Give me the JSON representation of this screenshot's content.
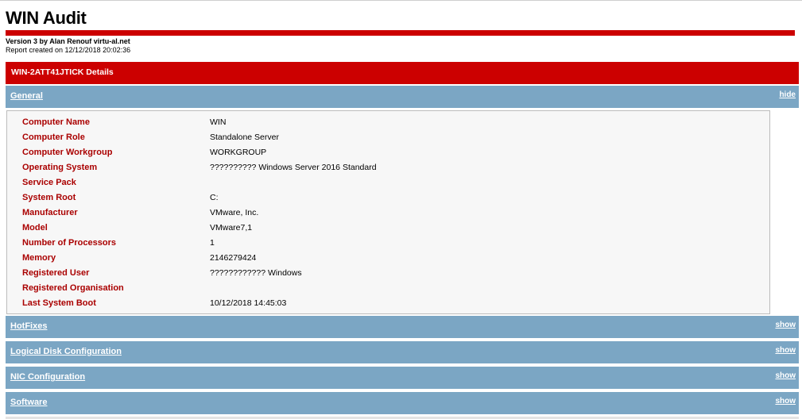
{
  "report": {
    "title": "WIN Audit",
    "version": "Version 3 by Alan Renouf virtu-al.net",
    "created": "Report created on 12/12/2018 20:02:36"
  },
  "details_header": "WIN-2ATT41JTICK Details",
  "sections": [
    {
      "label": "General",
      "toggle": "hide",
      "expanded": true
    },
    {
      "label": "HotFixes",
      "toggle": "show",
      "expanded": false
    },
    {
      "label": "Logical Disk Configuration",
      "toggle": "show",
      "expanded": false
    },
    {
      "label": "NIC Configuration",
      "toggle": "show",
      "expanded": false
    },
    {
      "label": "Software",
      "toggle": "show",
      "expanded": false
    }
  ],
  "general": {
    "rows": [
      {
        "key": "Computer Name",
        "value": "WIN"
      },
      {
        "key": "Computer Role",
        "value": "Standalone Server"
      },
      {
        "key": "Computer Workgroup",
        "value": "WORKGROUP"
      },
      {
        "key": "Operating System",
        "value": "?????????? Windows Server 2016 Standard"
      },
      {
        "key": "Service Pack",
        "value": ""
      },
      {
        "key": "System Root",
        "value": "C:"
      },
      {
        "key": "Manufacturer",
        "value": "VMware, Inc."
      },
      {
        "key": "Model",
        "value": "VMware7,1"
      },
      {
        "key": "Number of Processors",
        "value": "1"
      },
      {
        "key": "Memory",
        "value": "2146279424"
      },
      {
        "key": "Registered User",
        "value": "???????????? Windows"
      },
      {
        "key": "Registered Organisation",
        "value": ""
      },
      {
        "key": "Last System Boot",
        "value": "10/12/2018 14:45:03"
      }
    ]
  },
  "colors": {
    "accent_red": "#cc0000",
    "label_red": "#aa0000",
    "section_blue": "#7ba6c4"
  }
}
